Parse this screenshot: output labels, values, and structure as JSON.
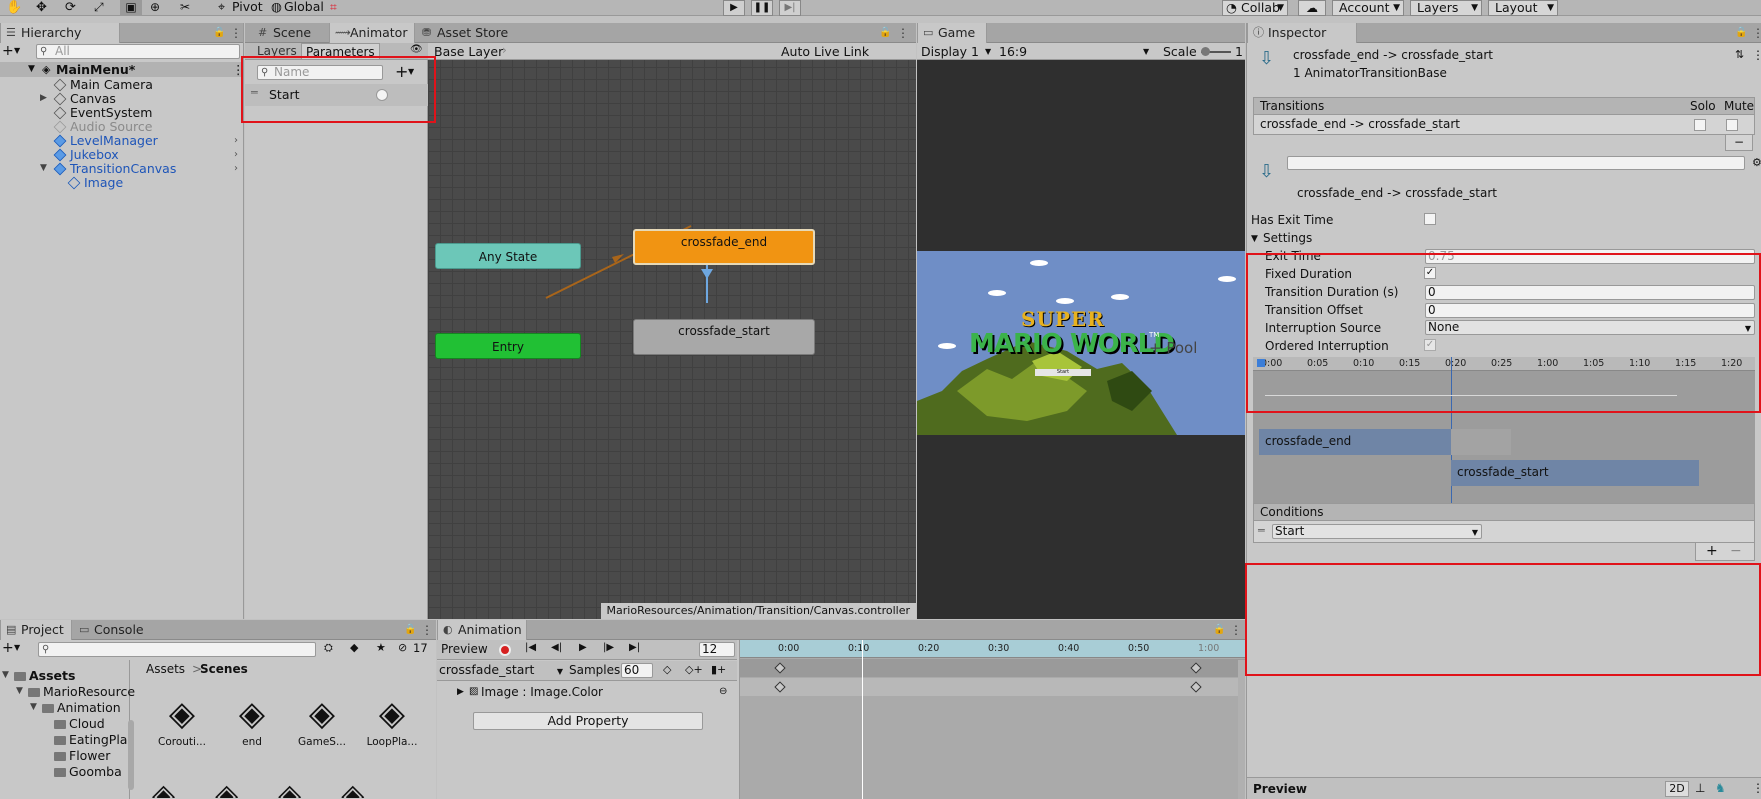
{
  "toolbar": {
    "pivot_label": "Pivot",
    "global_label": "Global",
    "collab_label": "Collab",
    "account_label": "Account",
    "layers_label": "Layers",
    "layout_label": "Layout"
  },
  "hierarchy": {
    "tab_label": "Hierarchy",
    "search_placeholder": "All",
    "scene_name": "MainMenu*",
    "items": [
      {
        "label": "Main Camera"
      },
      {
        "label": "Canvas"
      },
      {
        "label": "EventSystem"
      },
      {
        "label": "Audio Source"
      },
      {
        "label": "LevelManager"
      },
      {
        "label": "Jukebox"
      },
      {
        "label": "TransitionCanvas"
      },
      {
        "label": "Image"
      }
    ]
  },
  "animator": {
    "tabs": [
      "Scene",
      "Animator",
      "Asset Store"
    ],
    "subtabs": [
      "Layers",
      "Parameters"
    ],
    "name_placeholder": "Name",
    "parameter_name": "Start",
    "layer_label": "Base Layer",
    "auto_live_link": "Auto Live Link",
    "nodes": {
      "any_state": "Any State",
      "entry": "Entry",
      "crossfade_end": "crossfade_end",
      "crossfade_start": "crossfade_start"
    },
    "footer_path": "MarioResources/Animation/Transition/Canvas.controller"
  },
  "game": {
    "tab_label": "Game",
    "display_label": "Display 1",
    "aspect_label": "16:9",
    "scale_label": "Scale",
    "scale_value": "1",
    "title_super": "SUPER",
    "title_main": "MARIO WORLD",
    "title_tm": "TM",
    "title_pool": "+ Pool",
    "start_btn": "Start"
  },
  "inspector": {
    "tab_label": "Inspector",
    "header_title": "crossfade_end -> crossfade_start",
    "header_subtitle": "1 AnimatorTransitionBase",
    "transitions_label": "Transitions",
    "solo_label": "Solo",
    "mute_label": "Mute",
    "transition_row": "crossfade_end -> crossfade_start",
    "minus_label": "−",
    "sub_name": "crossfade_end -> crossfade_start",
    "has_exit_time_label": "Has Exit Time",
    "settings_label": "Settings",
    "exit_time_label": "Exit Time",
    "exit_time_value": "0.75",
    "fixed_duration_label": "Fixed Duration",
    "transition_duration_label": "Transition Duration (s)",
    "transition_duration_value": "0",
    "transition_offset_label": "Transition Offset",
    "transition_offset_value": "0",
    "interruption_source_label": "Interruption Source",
    "interruption_source_value": "None",
    "ordered_interruption_label": "Ordered Interruption",
    "timeline_ticks": [
      "0:00",
      "0:05",
      "0:10",
      "0:15",
      "0:20",
      "0:25",
      "1:00",
      "1:05",
      "1:10",
      "1:15",
      "1:20"
    ],
    "clip_end_label": "crossfade_end",
    "clip_start_label": "crossfade_start",
    "conditions_label": "Conditions",
    "condition_value": "Start",
    "plus_label": "+",
    "cond_minus_label": "−",
    "preview_label": "Preview",
    "preview_2d": "2D"
  },
  "project": {
    "tabs": [
      "Project",
      "Console"
    ],
    "hidden_count": "17",
    "breadcrumb_root": "Assets",
    "breadcrumb_sep": ">",
    "breadcrumb_current": "Scenes",
    "tree": [
      {
        "label": "Assets"
      },
      {
        "label": "MarioResource"
      },
      {
        "label": "Animation"
      },
      {
        "label": "Cloud"
      },
      {
        "label": "EatingPlar"
      },
      {
        "label": "Flower"
      },
      {
        "label": "Goomba"
      }
    ],
    "assets": [
      {
        "label": "Corouti..."
      },
      {
        "label": "end"
      },
      {
        "label": "GameS..."
      },
      {
        "label": "LoopPla..."
      }
    ]
  },
  "animation": {
    "tab_label": "Animation",
    "preview_label": "Preview",
    "frame_value": "12",
    "clip_value": "crossfade_start",
    "samples_label": "Samples",
    "samples_value": "60",
    "property_label": "Image : Image.Color",
    "add_property_label": "Add Property",
    "ticks": [
      "0:00",
      "0:10",
      "0:20",
      "0:30",
      "0:40",
      "0:50",
      "1:00"
    ]
  }
}
